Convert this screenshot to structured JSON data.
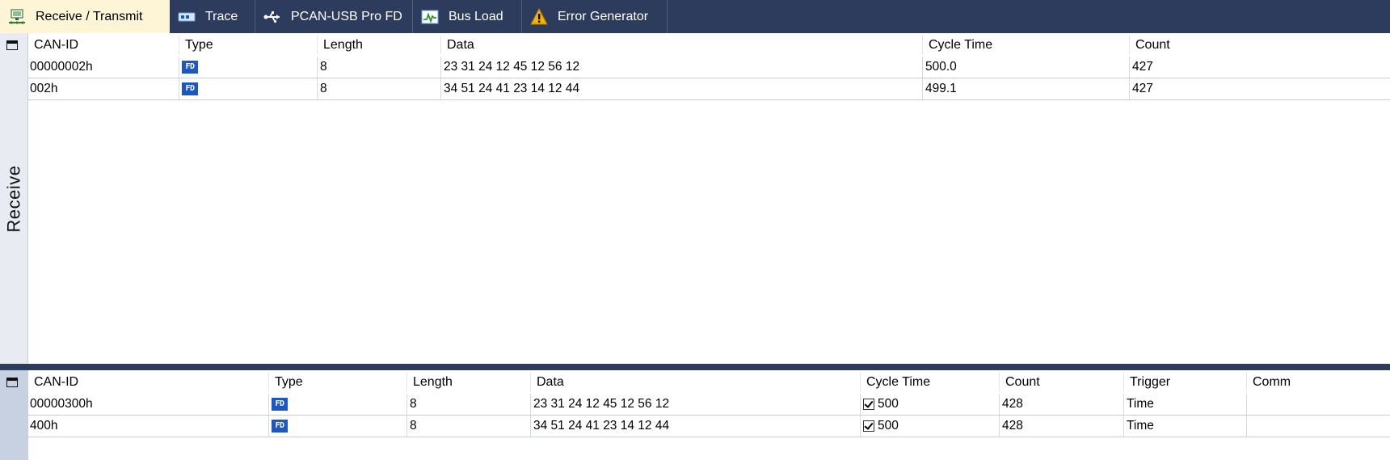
{
  "tabs": [
    {
      "label": "Receive / Transmit",
      "icon": "network-computer-icon",
      "active": true
    },
    {
      "label": "Trace",
      "icon": "trace-icon"
    },
    {
      "label": "PCAN-USB Pro FD",
      "icon": "usb-icon"
    },
    {
      "label": "Bus Load",
      "icon": "bus-load-icon"
    },
    {
      "label": "Error Generator",
      "icon": "warning-icon"
    }
  ],
  "receive": {
    "side_label": "Receive",
    "columns": [
      "CAN-ID",
      "Type",
      "Length",
      "Data",
      "Cycle Time",
      "Count"
    ],
    "rows": [
      {
        "can_id": "00000002h",
        "type": "FD",
        "length": "8",
        "data": "23 31 24 12 45 12 56 12",
        "cycle_time": "500.0",
        "count": "427"
      },
      {
        "can_id": "002h",
        "type": "FD",
        "length": "8",
        "data": "34 51 24 41 23 14 12 44",
        "cycle_time": "499.1",
        "count": "427"
      }
    ]
  },
  "transmit": {
    "columns": [
      "CAN-ID",
      "Type",
      "Length",
      "Data",
      "Cycle Time",
      "Count",
      "Trigger",
      "Comm"
    ],
    "rows": [
      {
        "can_id": "00000300h",
        "type": "FD",
        "length": "8",
        "data": "23 31 24 12 45 12 56 12",
        "cycle_enabled": true,
        "cycle_time": "500",
        "count": "428",
        "trigger": "Time"
      },
      {
        "can_id": "400h",
        "type": "FD",
        "length": "8",
        "data": "34 51 24 41 23 14 12 44",
        "cycle_enabled": true,
        "cycle_time": "500",
        "count": "428",
        "trigger": "Time"
      }
    ]
  },
  "colors": {
    "tabbar": "#2d3c5c",
    "active_tab": "#fdf5d6",
    "fd_badge": "#1c57c4"
  }
}
